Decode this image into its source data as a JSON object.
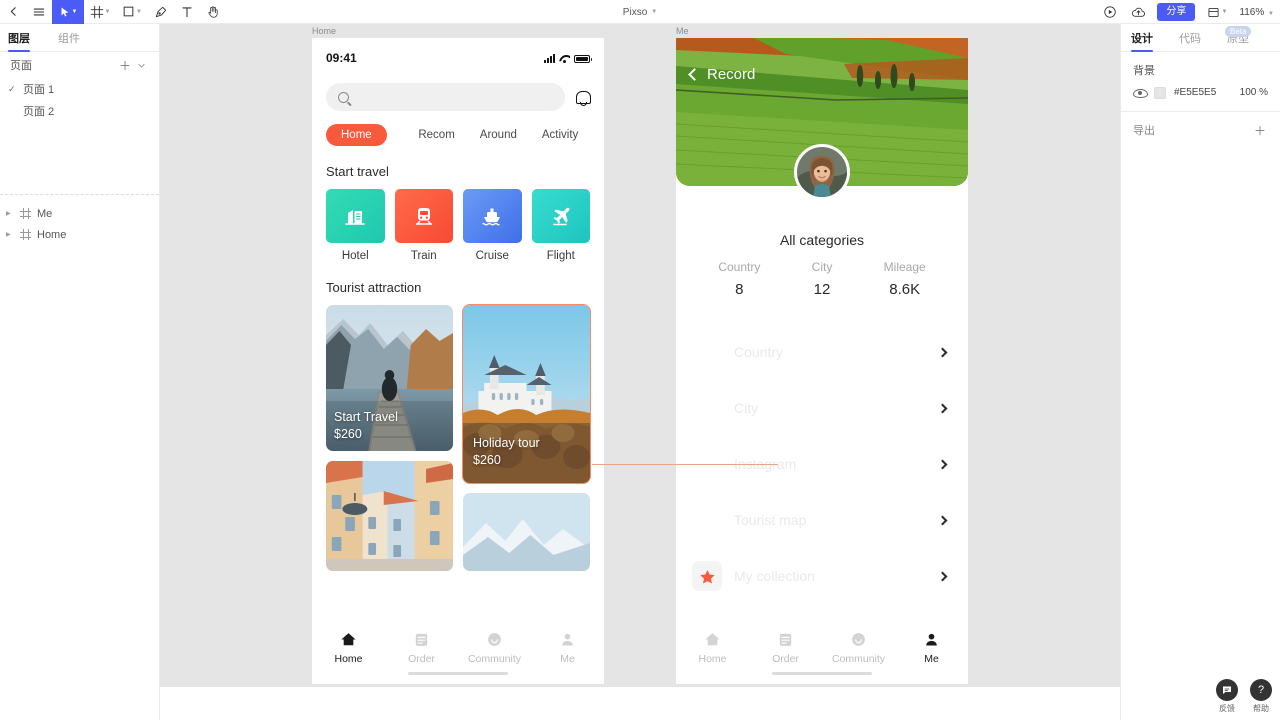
{
  "app": {
    "title": "Pixso",
    "zoom": "116%"
  },
  "toolbar": {
    "back_icon": "chevron-left-icon",
    "menu_icon": "hamburger-menu-icon",
    "move_icon": "cursor-move-icon",
    "frame_icon": "frame-icon",
    "shape_icon": "rectangle-icon",
    "pen_icon": "pen-icon",
    "text_icon": "text-icon",
    "hand_icon": "hand-icon",
    "present_icon": "play-icon",
    "cloud_icon": "cloud-upload-icon",
    "share_label": "分享",
    "layout_icon": "layout-icon"
  },
  "left_panel": {
    "tabs": [
      {
        "label": "图层",
        "selected": true
      },
      {
        "label": "组件",
        "selected": false
      }
    ],
    "pages_header": "页面",
    "add_icon": "plus-icon",
    "collapse_icon": "chevron-down-icon",
    "pages": [
      {
        "label": "页面 1",
        "selected": true
      },
      {
        "label": "页面 2",
        "selected": false
      }
    ],
    "layers": [
      {
        "label": "Me"
      },
      {
        "label": "Home"
      }
    ]
  },
  "right_panel": {
    "tabs": [
      {
        "label": "设计",
        "selected": true
      },
      {
        "label": "代码",
        "selected": false
      },
      {
        "label": "原型",
        "selected": false
      }
    ],
    "beta_badge": "Beta",
    "background": {
      "title": "背景",
      "hex": "#E5E5E5",
      "opacity": "100 %",
      "eye_icon": "eye-icon"
    },
    "export": {
      "title": "导出",
      "add_icon": "plus-icon"
    }
  },
  "helpers": [
    {
      "label": "反馈",
      "glyph": "💬",
      "icon": "feedback-icon"
    },
    {
      "label": "帮助",
      "glyph": "?",
      "icon": "help-icon"
    }
  ],
  "canvas": {
    "background_color": "#E5E5E5",
    "frames": [
      {
        "label": "Home"
      },
      {
        "label": "Me"
      }
    ]
  },
  "home_frame": {
    "status_bar": {
      "time": "09:41",
      "signal_icon": "cellular-signal-icon",
      "wifi_icon": "wifi-icon",
      "battery_icon": "battery-icon"
    },
    "search": {
      "placeholder": "",
      "icon": "search-icon"
    },
    "bell_icon": "notification-bell-icon",
    "tabs": [
      {
        "label": "Home",
        "active": true
      },
      {
        "label": "Recom",
        "active": false
      },
      {
        "label": "Around",
        "active": false
      },
      {
        "label": "Activity",
        "active": false
      }
    ],
    "section_start_travel": "Start travel",
    "categories": [
      {
        "label": "Hotel",
        "icon": "hotel-icon",
        "color": "#2ed3ae"
      },
      {
        "label": "Train",
        "icon": "train-icon",
        "color": "#fa5a3c"
      },
      {
        "label": "Cruise",
        "icon": "cruise-ship-icon",
        "color": "#4a7df0"
      },
      {
        "label": "Flight",
        "icon": "airplane-icon",
        "color": "#2ecfc4"
      }
    ],
    "section_tourist": "Tourist attraction",
    "cards": [
      {
        "title": "Start Travel",
        "price": "$260",
        "image": "mountain-lake-pier"
      },
      {
        "title": "Holiday tour",
        "price": "$260",
        "image": "castle-autumn-forest",
        "selected": true
      },
      {
        "title": "",
        "price": "",
        "image": "european-street"
      },
      {
        "title": "",
        "price": "",
        "image": "snow-mountain"
      }
    ],
    "bottom_nav": [
      {
        "label": "Home",
        "icon": "home-icon",
        "active": true
      },
      {
        "label": "Order",
        "icon": "order-icon",
        "active": false
      },
      {
        "label": "Community",
        "icon": "community-icon",
        "active": false
      },
      {
        "label": "Me",
        "icon": "person-icon",
        "active": false
      }
    ]
  },
  "me_frame": {
    "hero_image": "green-fields-landscape",
    "back_label": "Record",
    "back_icon": "chevron-left-icon",
    "avatar": "user-avatar-photo",
    "title": "All categories",
    "stats": [
      {
        "key": "Country",
        "value": "8"
      },
      {
        "key": "City",
        "value": "12"
      },
      {
        "key": "Mileage",
        "value": "8.6K"
      }
    ],
    "menu": [
      {
        "label": "Country",
        "icon": "",
        "chevron": "chevron-right-icon"
      },
      {
        "label": "City",
        "icon": "",
        "chevron": "chevron-right-icon"
      },
      {
        "label": "Instagram",
        "icon": "",
        "chevron": "chevron-right-icon"
      },
      {
        "label": "Tourist map",
        "icon": "",
        "chevron": "chevron-right-icon"
      },
      {
        "label": "My collection",
        "icon": "star-icon",
        "chevron": "chevron-right-icon"
      }
    ],
    "bottom_nav": [
      {
        "label": "Home",
        "icon": "home-icon",
        "active": false
      },
      {
        "label": "Order",
        "icon": "order-icon",
        "active": false
      },
      {
        "label": "Community",
        "icon": "community-icon",
        "active": false
      },
      {
        "label": "Me",
        "icon": "person-icon",
        "active": true
      }
    ]
  }
}
